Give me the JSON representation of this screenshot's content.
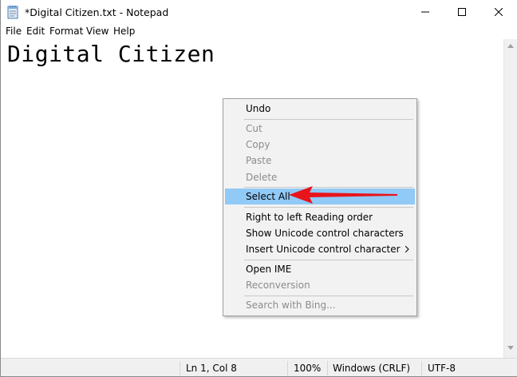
{
  "window": {
    "title": "*Digital Citizen.txt - Notepad",
    "app_icon": "notepad-icon"
  },
  "menubar": {
    "items": [
      {
        "label": "File"
      },
      {
        "label": "Edit"
      },
      {
        "label": "Format"
      },
      {
        "label": "View"
      },
      {
        "label": "Help"
      }
    ]
  },
  "editor": {
    "text": "Digital Citizen"
  },
  "context_menu": {
    "items": [
      {
        "label": "Undo",
        "enabled": true
      },
      {
        "label": "Cut",
        "enabled": false
      },
      {
        "label": "Copy",
        "enabled": false
      },
      {
        "label": "Paste",
        "enabled": false
      },
      {
        "label": "Delete",
        "enabled": false
      },
      {
        "label": "Select All",
        "enabled": true,
        "highlighted": true
      },
      {
        "label": "Right to left Reading order",
        "enabled": true
      },
      {
        "label": "Show Unicode control characters",
        "enabled": true
      },
      {
        "label": "Insert Unicode control character",
        "enabled": true,
        "submenu": true
      },
      {
        "label": "Open IME",
        "enabled": true
      },
      {
        "label": "Reconversion",
        "enabled": false
      },
      {
        "label": "Search with Bing...",
        "enabled": false
      }
    ],
    "highlight_color": "#91c9f7",
    "annotation_arrow_color": "#e8141b"
  },
  "statusbar": {
    "position": "Ln 1, Col 8",
    "zoom": "100%",
    "line_ending": "Windows (CRLF)",
    "encoding": "UTF-8"
  }
}
